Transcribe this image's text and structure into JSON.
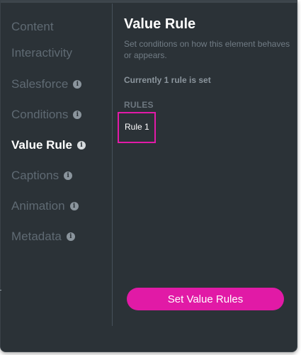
{
  "sidebar": {
    "items": [
      {
        "label": "Content",
        "info": false,
        "active": false
      },
      {
        "label": "Interactivity",
        "info": false,
        "active": false
      },
      {
        "label": "Salesforce",
        "info": true,
        "active": false
      },
      {
        "label": "Conditions",
        "info": true,
        "active": false
      },
      {
        "label": "Value Rule",
        "info": true,
        "active": true
      },
      {
        "label": "Captions",
        "info": true,
        "active": false
      },
      {
        "label": "Animation",
        "info": true,
        "active": false
      },
      {
        "label": "Metadata",
        "info": true,
        "active": false
      }
    ]
  },
  "main": {
    "title": "Value Rule",
    "description": "Set conditions on how this element behaves or appears.",
    "status": "Currently 1 rule is set",
    "rules_label": "RULES",
    "rules": [
      {
        "label": "Rule 1"
      }
    ],
    "primary_button": "Set Value Rules"
  },
  "icons": {
    "info": "info-icon",
    "info_glyph": "i"
  },
  "colors": {
    "panel_bg": "#2b3237",
    "accent": "#e11aa6",
    "active_text": "#ffffff",
    "inactive_text": "#5f6a73"
  }
}
